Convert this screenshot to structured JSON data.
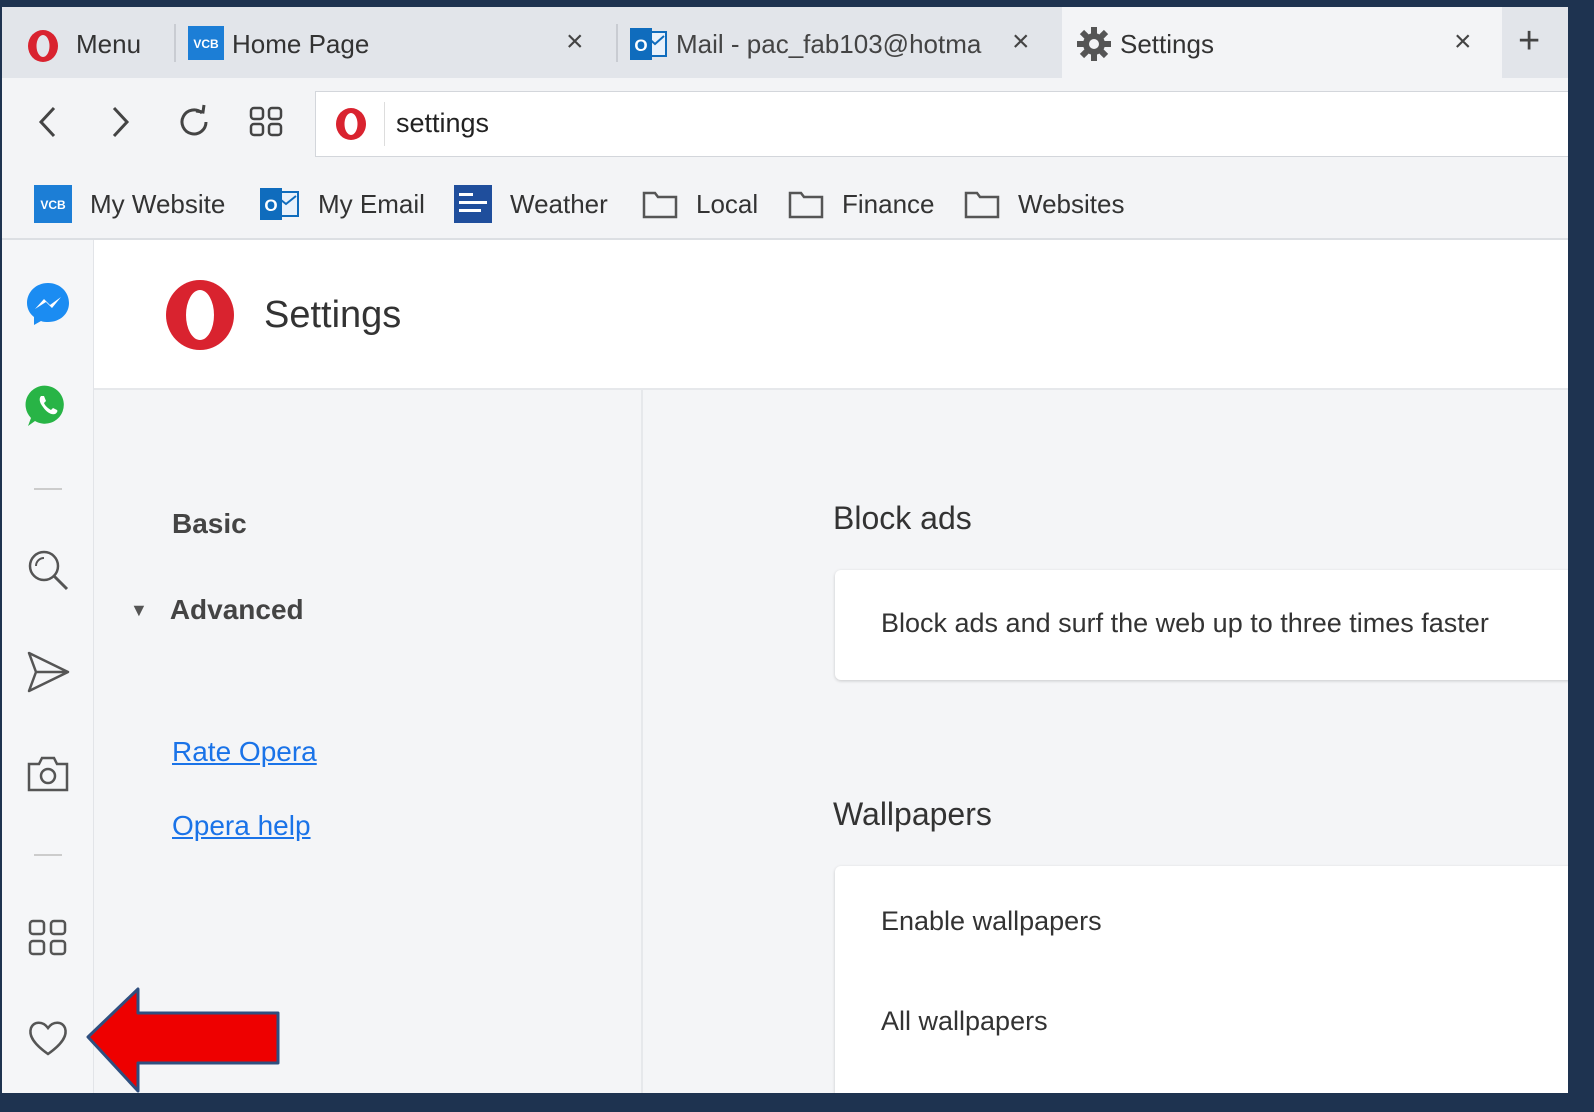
{
  "browser": {
    "menu_label": "Menu",
    "tabs": [
      {
        "label": "Home Page",
        "icon": "vcb-favicon",
        "close": "×"
      },
      {
        "label": "Mail - pac_fab103@hotma",
        "icon": "outlook-favicon",
        "close": "×"
      },
      {
        "label": "Settings",
        "icon": "gear-icon",
        "close": "×",
        "active": true
      }
    ],
    "new_tab": "+",
    "address": "settings",
    "vcb_badge": "VCB",
    "outlook_badge": "O"
  },
  "bookmarks": [
    {
      "label": "My Website",
      "icon": "vcb-favicon"
    },
    {
      "label": "My Email",
      "icon": "outlook-favicon"
    },
    {
      "label": "Weather",
      "icon": "weather-channel-favicon"
    },
    {
      "label": "Local",
      "icon": "folder-icon"
    },
    {
      "label": "Finance",
      "icon": "folder-icon"
    },
    {
      "label": "Websites",
      "icon": "folder-icon"
    }
  ],
  "sidebar": {
    "items": [
      "messenger-icon",
      "whatsapp-icon",
      "search-icon",
      "send-icon",
      "camera-icon",
      "extensions-icon",
      "heart-icon"
    ]
  },
  "settings": {
    "title": "Settings",
    "nav": {
      "basic": "Basic",
      "advanced": "Advanced",
      "links": [
        "Rate Opera",
        "Opera help"
      ]
    },
    "sections": {
      "block_ads": {
        "title": "Block ads",
        "rows": [
          "Block ads and surf the web up to three times faster"
        ]
      },
      "wallpapers": {
        "title": "Wallpapers",
        "rows": [
          "Enable wallpapers",
          "All wallpapers"
        ]
      }
    }
  },
  "colors": {
    "opera_red": "#d9232f",
    "link_blue": "#1a73e8",
    "arrow_red": "#ee0000",
    "arrow_outline": "#2f4f7f"
  }
}
